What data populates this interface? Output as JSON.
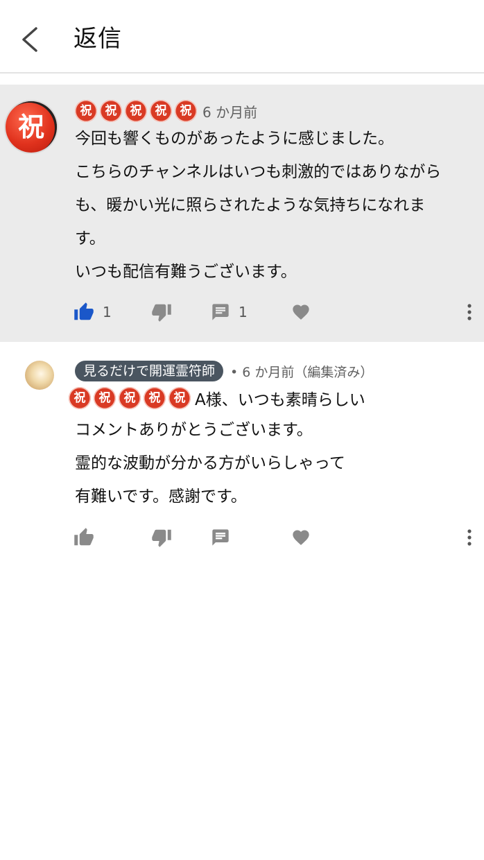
{
  "header": {
    "title": "返信"
  },
  "parent_comment": {
    "badge": "祝",
    "badges": [
      "祝",
      "祝",
      "祝",
      "祝",
      "祝"
    ],
    "time": "6 か月前",
    "lines": [
      "今回も響くものがあったように感じました。",
      "こちらのチャンネルはいつも刺激的ではありながら",
      "も、暖かい光に照らされたような気持ちになれま",
      "す。",
      "いつも配信有難うございます。"
    ],
    "likes": "1",
    "replies": "1"
  },
  "reply_comment": {
    "author": "見るだけで開運霊符師",
    "time": "• 6 か月前（編集済み）",
    "badges": [
      "祝",
      "祝",
      "祝",
      "祝",
      "祝"
    ],
    "first_line_suffix": "A様、いつも素晴らしい",
    "lines": [
      "コメントありがとうございます。",
      "霊的な波動が分かる方がいらしゃって",
      "有難いです。感謝です。"
    ]
  },
  "colors": {
    "like_active": "#1a57c9",
    "icon_gray": "#8a8a8a",
    "parent_bg": "#ebebeb",
    "badge_red": "#d93a24",
    "author_chip": "#4a5560"
  },
  "icons": [
    "back-arrow-icon",
    "thumbs-up-icon",
    "thumbs-down-icon",
    "reply-comment-icon",
    "heart-icon",
    "more-vert-icon"
  ]
}
